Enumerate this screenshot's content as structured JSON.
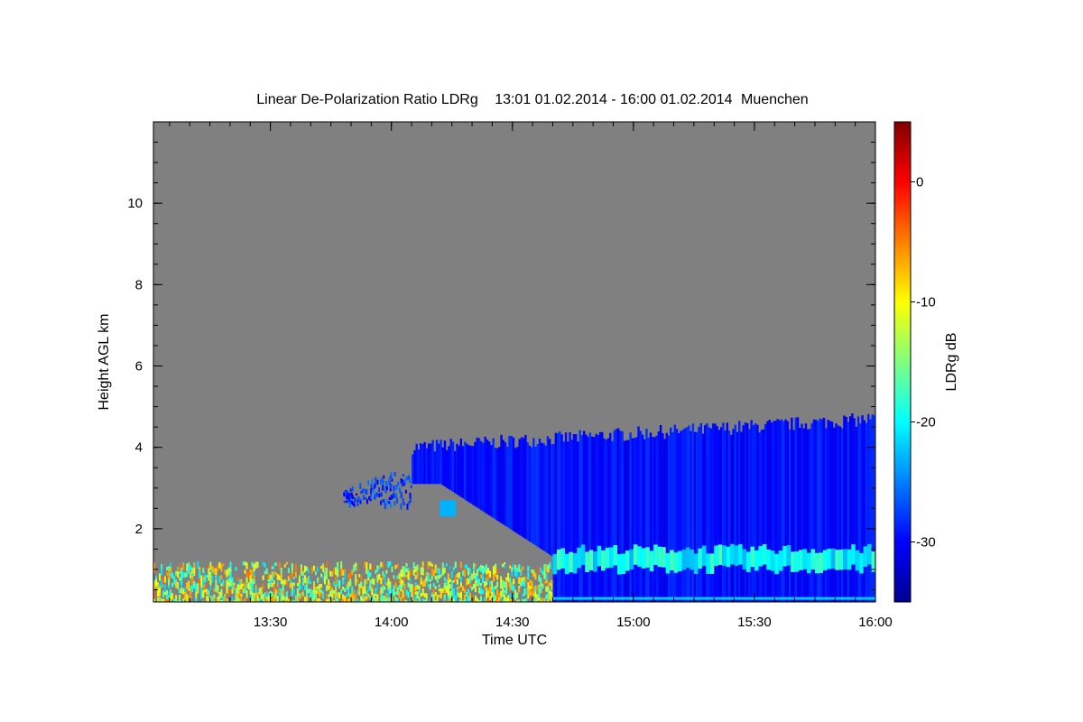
{
  "chart_data": {
    "type": "heatmap",
    "title": "Linear De-Polarization Ratio LDRg",
    "period": "13:01 01.02.2014 - 16:00 01.02.2014",
    "location": "Muenchen",
    "xlabel": "Time UTC",
    "ylabel": "Height AGL km",
    "colorbar_label": "LDRg dB",
    "x_range": [
      "13:01",
      "16:00"
    ],
    "x_ticks": [
      "13:30",
      "14:00",
      "14:30",
      "15:00",
      "15:30",
      "16:00"
    ],
    "ylim": [
      0.2,
      12
    ],
    "y_ticks": [
      2,
      4,
      6,
      8,
      10
    ],
    "colorbar_range": [
      -35,
      5
    ],
    "colorbar_ticks": [
      0,
      -10,
      -20,
      -30
    ],
    "colormap": "jet",
    "no_signal_color": "#808080",
    "features": [
      {
        "name": "cloud layer top",
        "start_time": "14:05",
        "end_time": "16:00",
        "top_km": 4.0,
        "top_km_end": 4.7,
        "ldr_db": -29
      },
      {
        "name": "thin cloud streaks",
        "start_time": "13:48",
        "end_time": "14:05",
        "base_km": 2.6,
        "top_km": 3.6,
        "ldr_db": -28
      },
      {
        "name": "bright band layer",
        "start_time": "14:40",
        "end_time": "16:00",
        "base_km": 1.0,
        "top_km": 1.5,
        "ldr_db": -20
      },
      {
        "name": "aerosol boundary layer",
        "start_time": "13:01",
        "end_time": "14:40",
        "base_km": 0.2,
        "top_km": 1.2,
        "ldr_db": -13
      }
    ]
  }
}
